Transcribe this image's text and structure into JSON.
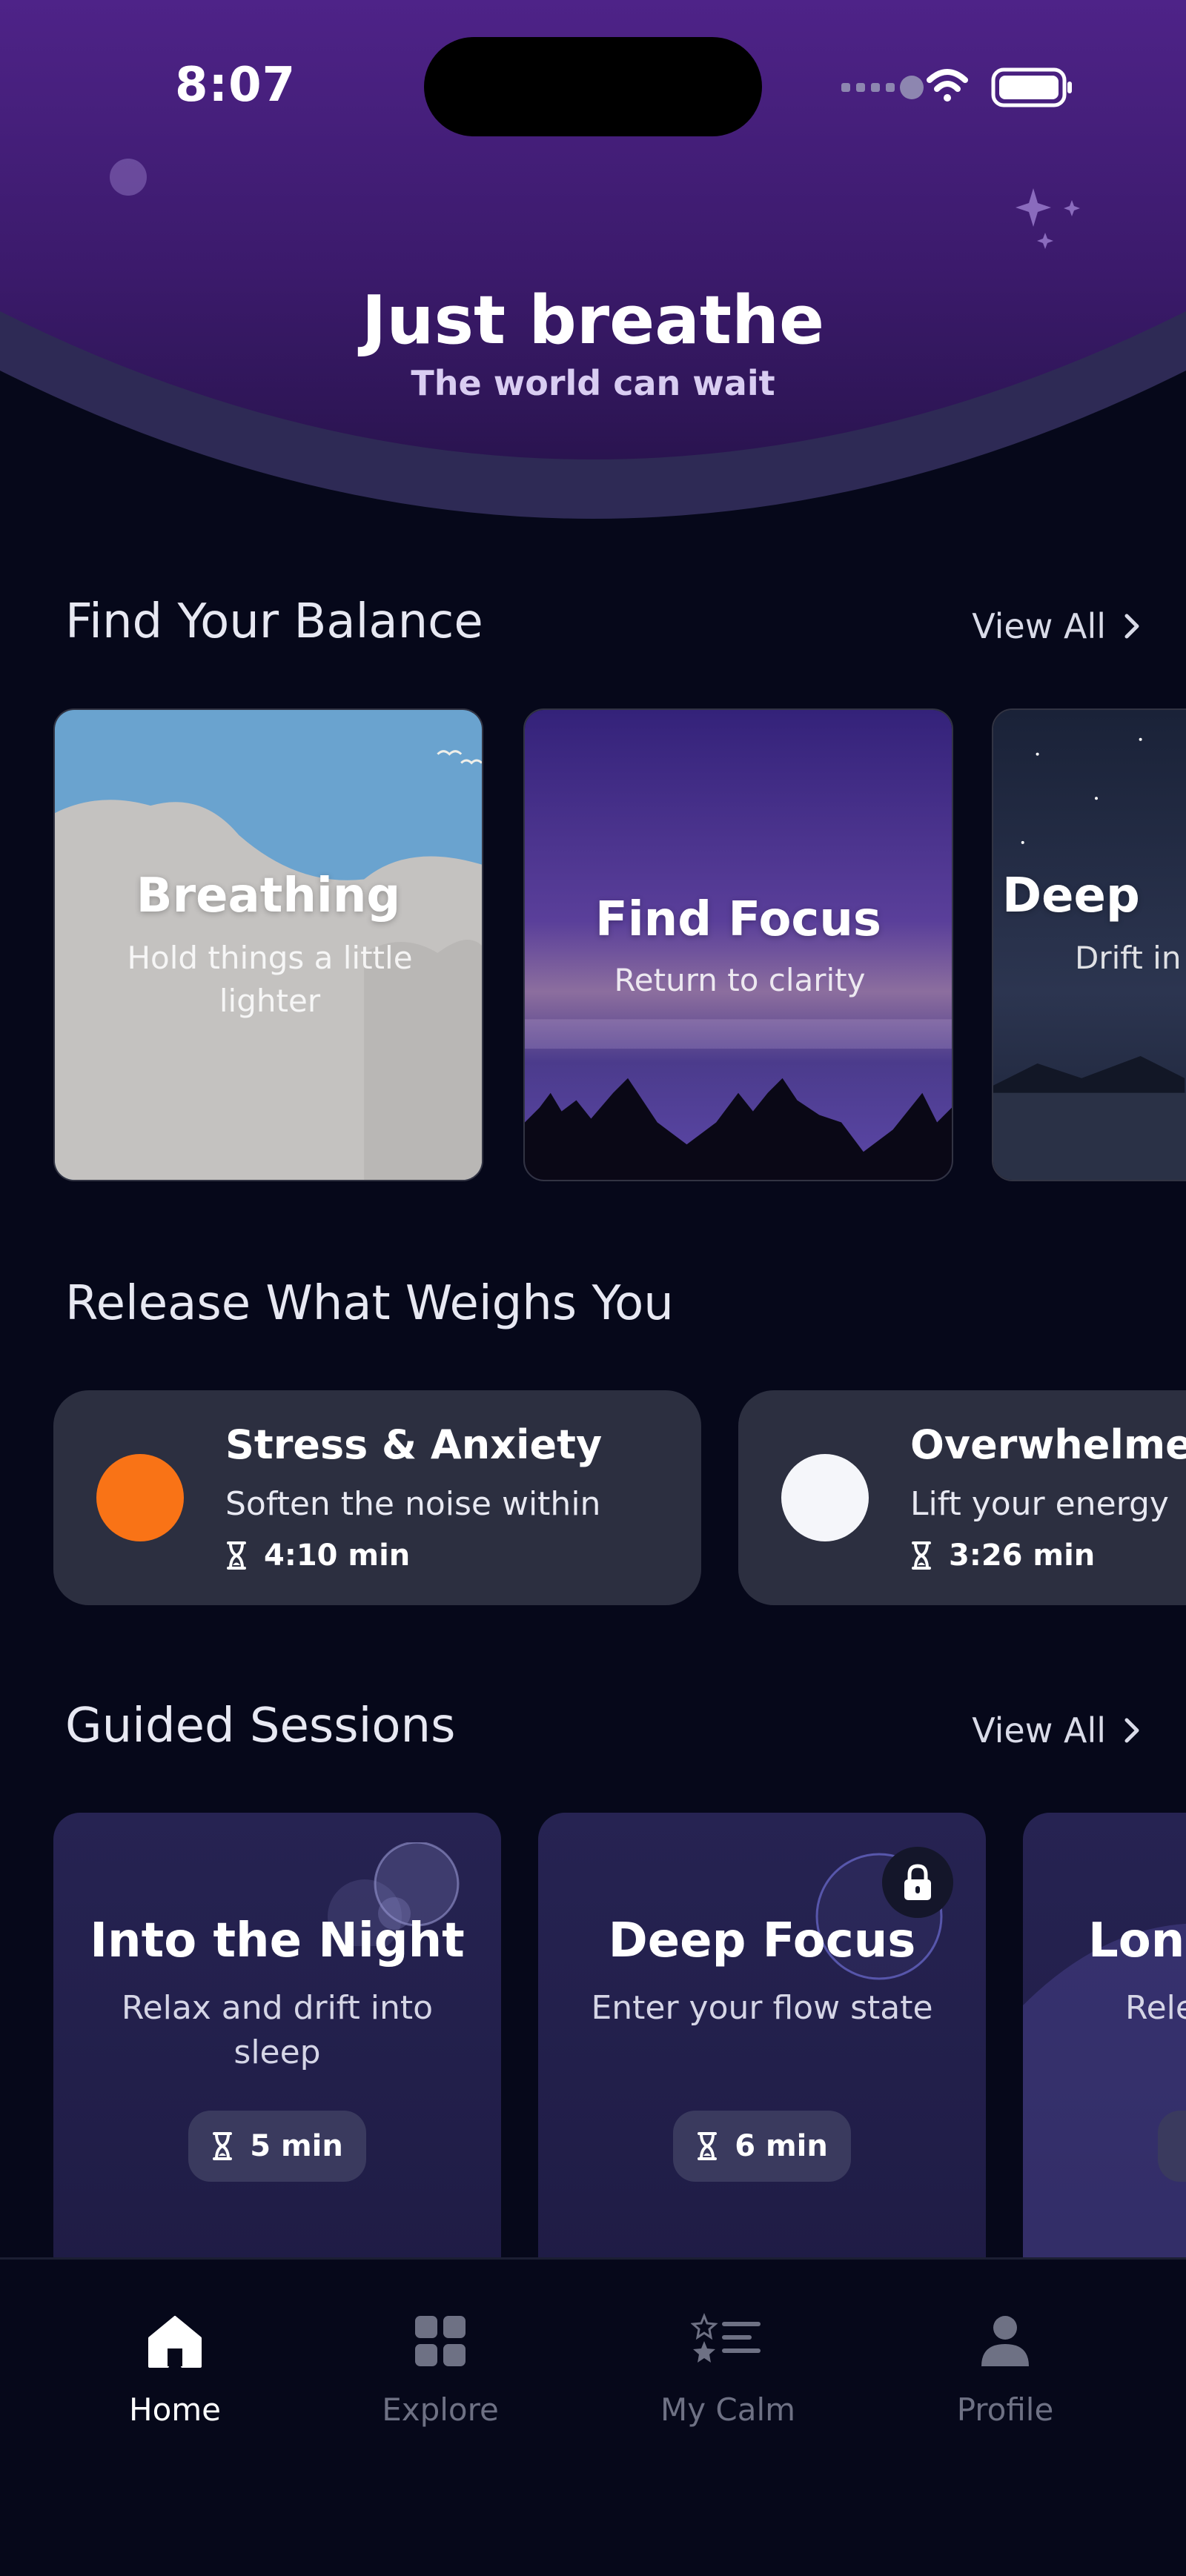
{
  "status_bar": {
    "time": "8:07"
  },
  "hero": {
    "title": "Just breathe",
    "subtitle": "The world can wait"
  },
  "balance": {
    "title": "Find Your Balance",
    "view_all": "View All",
    "cards": [
      {
        "title": "Breathing",
        "subtitle": "Hold things a little lighter"
      },
      {
        "title": "Find Focus",
        "subtitle": "Return to clarity"
      },
      {
        "title": "Deep",
        "subtitle": "Drift in"
      }
    ]
  },
  "release": {
    "title": "Release What Weighs You",
    "cards": [
      {
        "title": "Stress & Anxiety",
        "subtitle": "Soften the noise within",
        "duration": "4:10 min",
        "dot_color": "#f97316"
      },
      {
        "title": "Overwhelmed",
        "subtitle": "Lift your energy",
        "duration": "3:26 min",
        "dot_color": "#f5f6fa"
      }
    ]
  },
  "guided": {
    "title": "Guided Sessions",
    "view_all": "View All",
    "cards": [
      {
        "title": "Into the Night",
        "subtitle": "Relax and drift into sleep",
        "duration": "5 min",
        "locked": false
      },
      {
        "title": "Deep Focus",
        "subtitle": "Enter your flow state",
        "duration": "6 min",
        "locked": true
      },
      {
        "title": "Long",
        "subtitle": "Rele"
      }
    ]
  },
  "tabbar": {
    "items": [
      {
        "label": "Home",
        "icon": "home-icon",
        "active": true
      },
      {
        "label": "Explore",
        "icon": "grid-icon",
        "active": false
      },
      {
        "label": "My Calm",
        "icon": "star-list-icon",
        "active": false
      },
      {
        "label": "Profile",
        "icon": "person-icon",
        "active": false
      }
    ]
  },
  "colors": {
    "background": "#06081a",
    "header_purple": "#4a2183",
    "card_surface": "#2c2f40",
    "guided_surface": "#262352",
    "accent_orange": "#f97316"
  }
}
